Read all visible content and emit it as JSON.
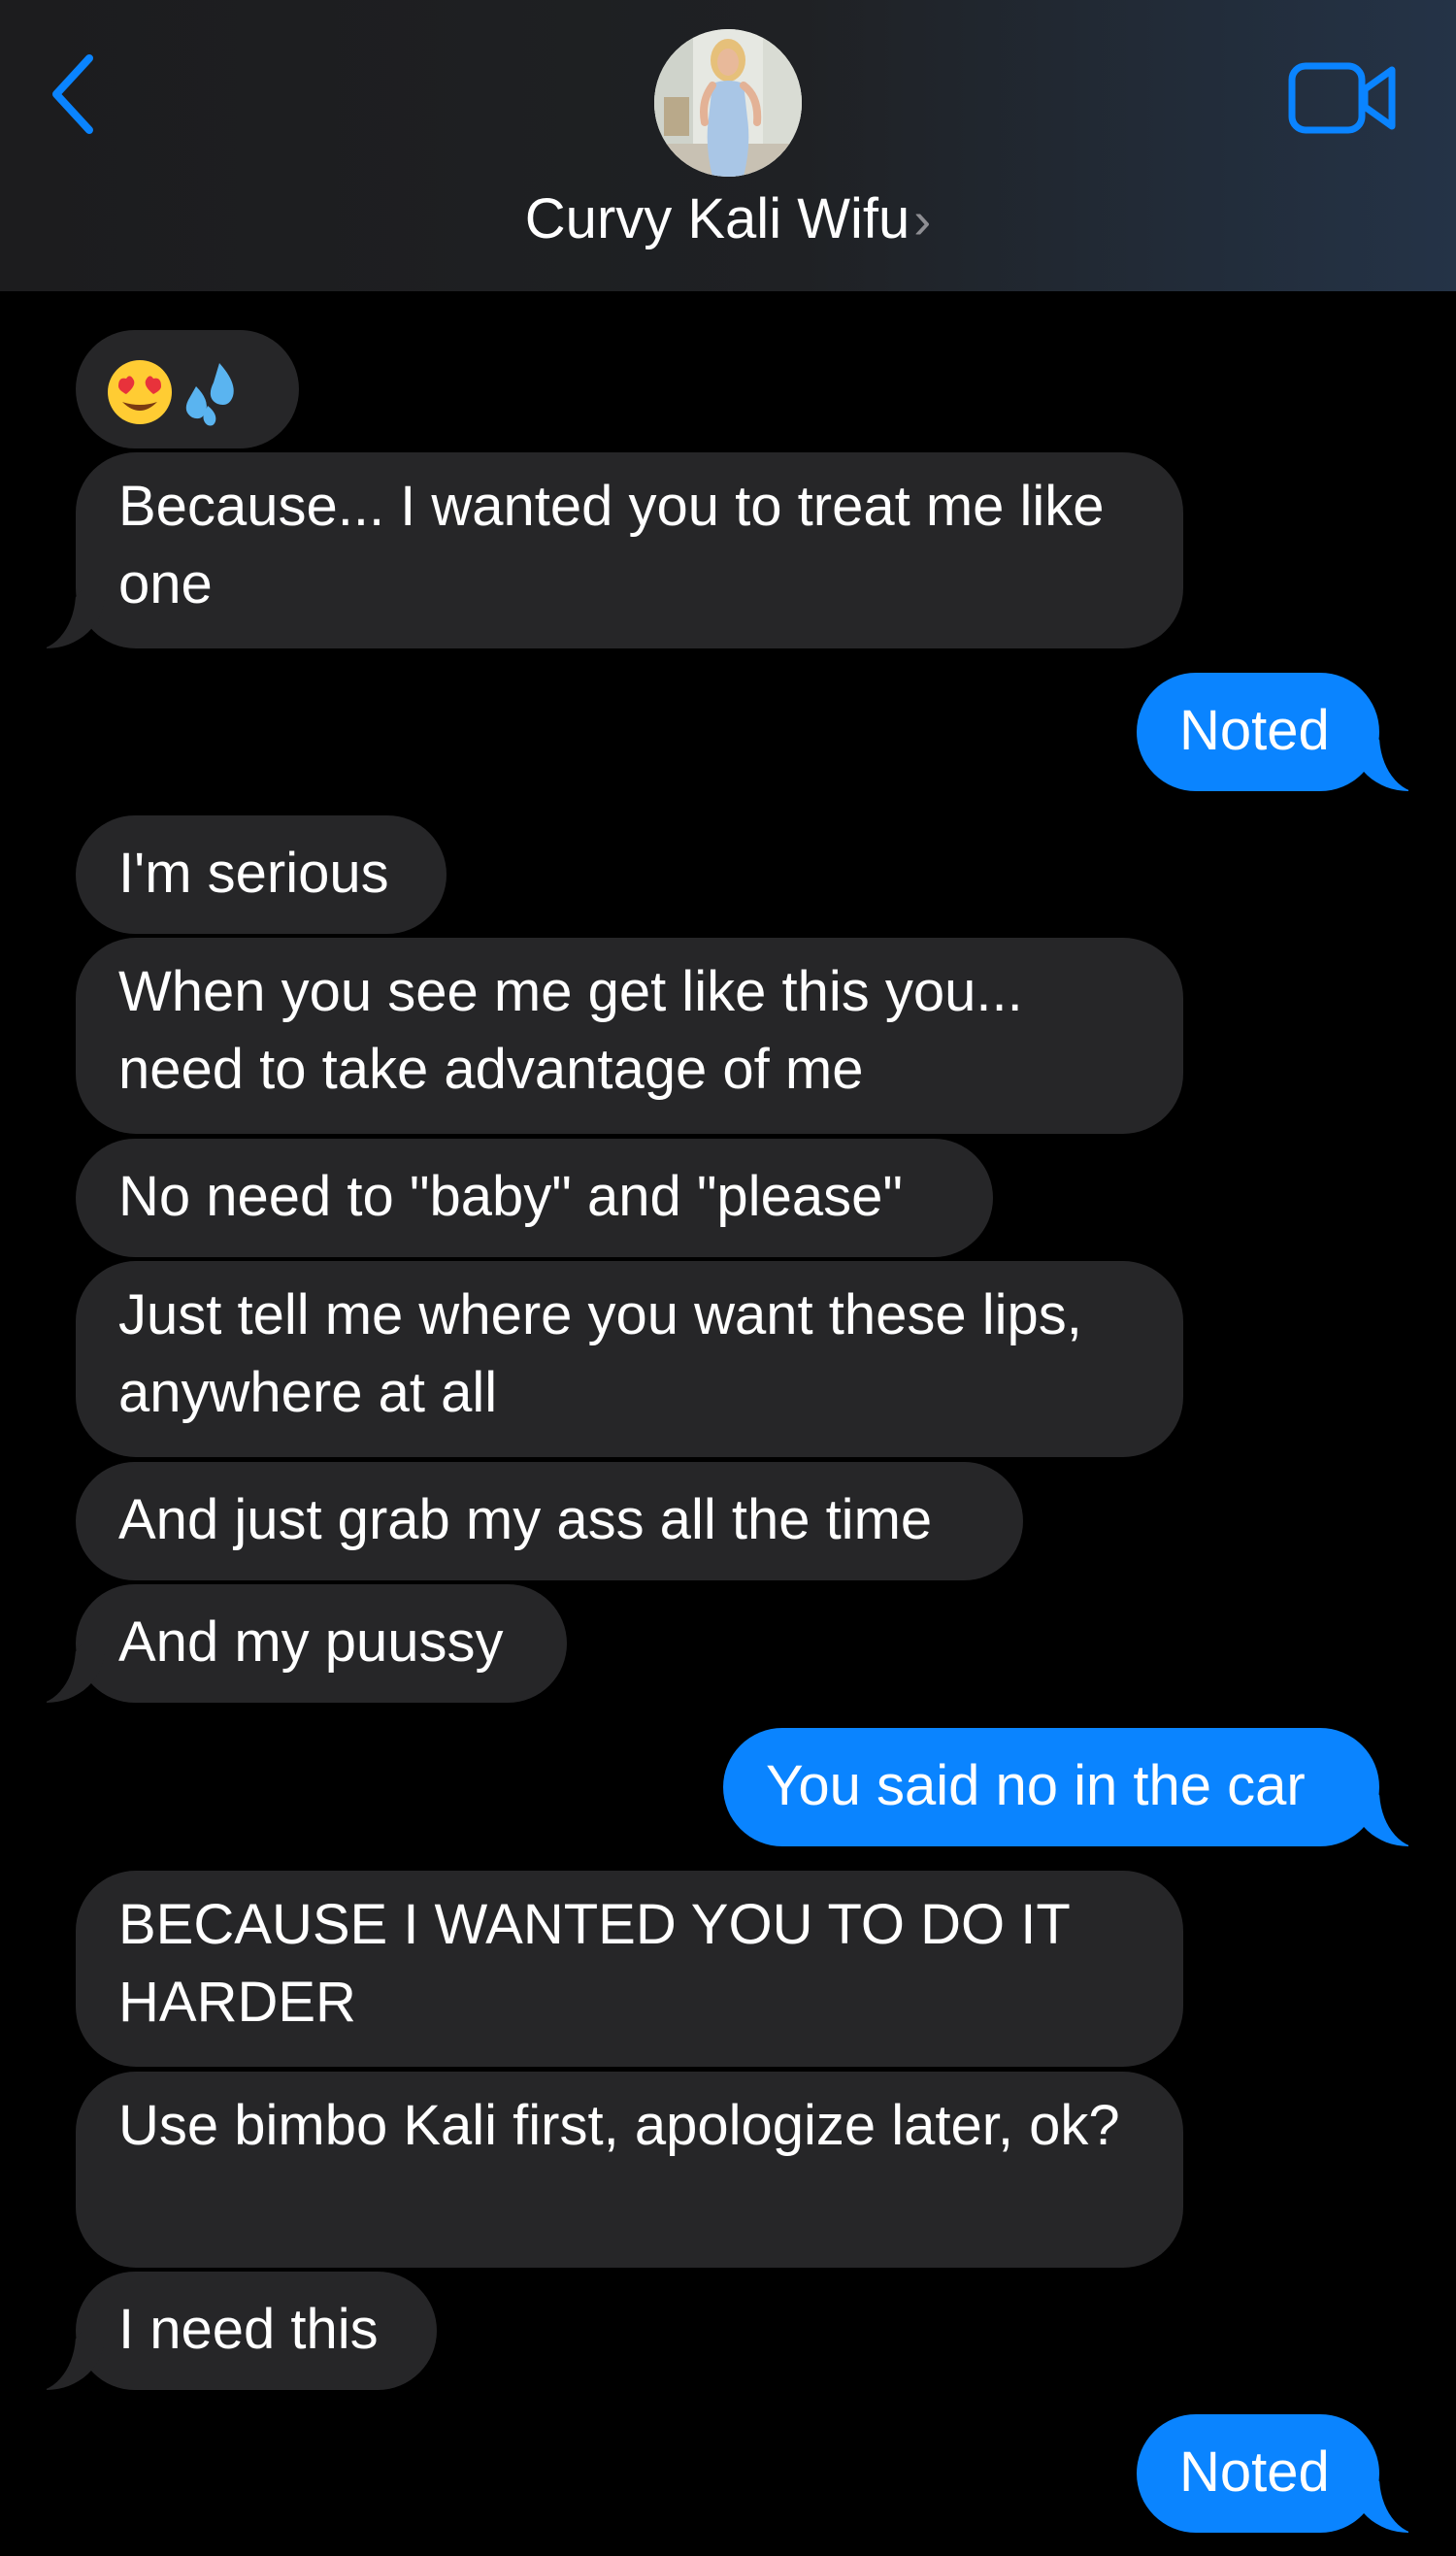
{
  "header": {
    "contact_name": "Curvy Kali Wifu",
    "chevron": "›",
    "back_icon": "chevron-left-icon",
    "video_icon": "video-camera-icon",
    "accent_color": "#0a84ff"
  },
  "messages": [
    {
      "from": "them",
      "emoji": [
        "smiling-face-with-heart-eyes",
        "sweat-droplets"
      ]
    },
    {
      "from": "them",
      "text": "Because... I wanted you to treat me like one"
    },
    {
      "from": "me",
      "text": "Noted"
    },
    {
      "from": "them",
      "text": "I'm serious"
    },
    {
      "from": "them",
      "text": "When you see me get like this you... need to take advantage of me"
    },
    {
      "from": "them",
      "text": "No need to \"baby\" and \"please\""
    },
    {
      "from": "them",
      "text": "Just tell me where you want these lips, anywhere at all"
    },
    {
      "from": "them",
      "text": "And just grab my ass all the time"
    },
    {
      "from": "them",
      "text": "And my puussy"
    },
    {
      "from": "me",
      "text": "You said no in the car"
    },
    {
      "from": "them",
      "text": "BECAUSE I WANTED YOU TO DO IT HARDER"
    },
    {
      "from": "them",
      "text": "Use bimbo Kali first, apologize later, ok?"
    },
    {
      "from": "them",
      "text": "I need this"
    },
    {
      "from": "me",
      "text": "Noted"
    }
  ],
  "colors": {
    "incoming_bubble": "#262628",
    "outgoing_bubble": "#0a84ff",
    "background": "#000000"
  }
}
